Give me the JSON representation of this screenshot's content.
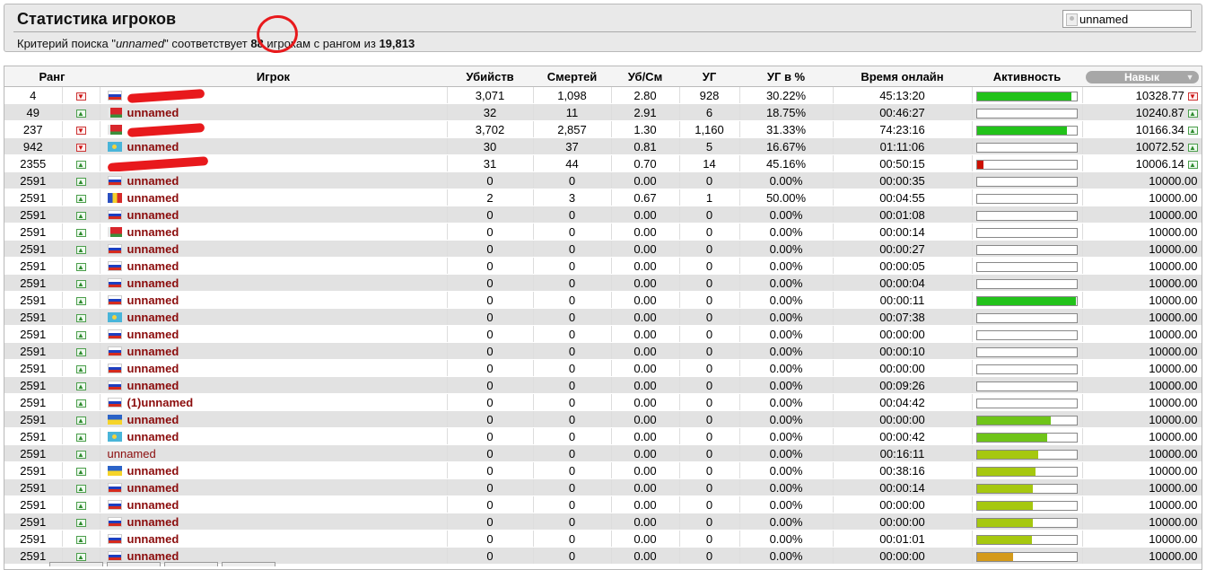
{
  "header": {
    "title": "Статистика игроков",
    "summary": {
      "prefix": "Критерий поиска \"",
      "query": "unnamed",
      "middle": "\" соответствует ",
      "count": "88",
      "after": " игрокам с рангом из ",
      "total": "19,813"
    },
    "search_value": "unnamed"
  },
  "columns": [
    "Ранг",
    "Игрок",
    "Убийств",
    "Смертей",
    "Уб/См",
    "УГ",
    "УГ в %",
    "Время онлайн",
    "Активность",
    "Навык"
  ],
  "colors": {
    "name": "#8b0c0c",
    "bar_green": "#22c21a",
    "bar_lime": "#a6c80f",
    "bar_red": "#cc1100",
    "bar_orange": "#d49a1a"
  },
  "rows": [
    {
      "rank": "4",
      "trend": "down",
      "flag": "ru",
      "name": "",
      "hidden": true,
      "kills": "3,071",
      "deaths": "1,098",
      "kd": "2.80",
      "hs": "928",
      "hsp": "30.22%",
      "time": "45:13:20",
      "activity": 95,
      "bar": "green",
      "skill": "10328.77",
      "strend": "down"
    },
    {
      "rank": "49",
      "trend": "up",
      "flag": "by",
      "name": "unnamed",
      "kills": "32",
      "deaths": "11",
      "kd": "2.91",
      "hs": "6",
      "hsp": "18.75%",
      "time": "00:46:27",
      "activity": 0,
      "bar": "green",
      "skill": "10240.87",
      "strend": "up"
    },
    {
      "rank": "237",
      "trend": "down",
      "flag": "by",
      "name": "",
      "hidden": true,
      "kills": "3,702",
      "deaths": "2,857",
      "kd": "1.30",
      "hs": "1,160",
      "hsp": "31.33%",
      "time": "74:23:16",
      "activity": 90,
      "bar": "green",
      "skill": "10166.34",
      "strend": "up"
    },
    {
      "rank": "942",
      "trend": "down",
      "flag": "kz",
      "name": "unnamed",
      "kills": "30",
      "deaths": "37",
      "kd": "0.81",
      "hs": "5",
      "hsp": "16.67%",
      "time": "01:11:06",
      "activity": 0,
      "bar": "green",
      "skill": "10072.52",
      "strend": "up"
    },
    {
      "rank": "2355",
      "trend": "up",
      "flag": "",
      "name": "",
      "hidden": true,
      "wide": true,
      "kills": "31",
      "deaths": "44",
      "kd": "0.70",
      "hs": "14",
      "hsp": "45.16%",
      "time": "00:50:15",
      "activity": 6,
      "bar": "red",
      "skill": "10006.14",
      "strend": "up"
    },
    {
      "rank": "2591",
      "trend": "up",
      "flag": "ru",
      "name": "unnamed",
      "kills": "0",
      "deaths": "0",
      "kd": "0.00",
      "hs": "0",
      "hsp": "0.00%",
      "time": "00:00:35",
      "activity": 0,
      "bar": "green",
      "skill": "10000.00",
      "strend": ""
    },
    {
      "rank": "2591",
      "trend": "up",
      "flag": "md",
      "name": "unnamed",
      "kills": "2",
      "deaths": "3",
      "kd": "0.67",
      "hs": "1",
      "hsp": "50.00%",
      "time": "00:04:55",
      "activity": 0,
      "bar": "green",
      "skill": "10000.00",
      "strend": ""
    },
    {
      "rank": "2591",
      "trend": "up",
      "flag": "ru",
      "name": "unnamed",
      "kills": "0",
      "deaths": "0",
      "kd": "0.00",
      "hs": "0",
      "hsp": "0.00%",
      "time": "00:01:08",
      "activity": 0,
      "bar": "green",
      "skill": "10000.00",
      "strend": ""
    },
    {
      "rank": "2591",
      "trend": "up",
      "flag": "by",
      "name": "unnamed",
      "kills": "0",
      "deaths": "0",
      "kd": "0.00",
      "hs": "0",
      "hsp": "0.00%",
      "time": "00:00:14",
      "activity": 0,
      "bar": "green",
      "skill": "10000.00",
      "strend": ""
    },
    {
      "rank": "2591",
      "trend": "up",
      "flag": "ru",
      "name": "unnamed",
      "kills": "0",
      "deaths": "0",
      "kd": "0.00",
      "hs": "0",
      "hsp": "0.00%",
      "time": "00:00:27",
      "activity": 0,
      "bar": "green",
      "skill": "10000.00",
      "strend": ""
    },
    {
      "rank": "2591",
      "trend": "up",
      "flag": "ru",
      "name": "unnamed",
      "kills": "0",
      "deaths": "0",
      "kd": "0.00",
      "hs": "0",
      "hsp": "0.00%",
      "time": "00:00:05",
      "activity": 0,
      "bar": "green",
      "skill": "10000.00",
      "strend": ""
    },
    {
      "rank": "2591",
      "trend": "up",
      "flag": "ru",
      "name": "unnamed",
      "kills": "0",
      "deaths": "0",
      "kd": "0.00",
      "hs": "0",
      "hsp": "0.00%",
      "time": "00:00:04",
      "activity": 0,
      "bar": "green",
      "skill": "10000.00",
      "strend": ""
    },
    {
      "rank": "2591",
      "trend": "up",
      "flag": "ru",
      "name": "unnamed",
      "kills": "0",
      "deaths": "0",
      "kd": "0.00",
      "hs": "0",
      "hsp": "0.00%",
      "time": "00:00:11",
      "activity": 99,
      "bar": "green",
      "skill": "10000.00",
      "strend": ""
    },
    {
      "rank": "2591",
      "trend": "up",
      "flag": "kz",
      "name": "unnamed",
      "kills": "0",
      "deaths": "0",
      "kd": "0.00",
      "hs": "0",
      "hsp": "0.00%",
      "time": "00:07:38",
      "activity": 0,
      "bar": "green",
      "skill": "10000.00",
      "strend": ""
    },
    {
      "rank": "2591",
      "trend": "up",
      "flag": "ru",
      "name": "unnamed",
      "kills": "0",
      "deaths": "0",
      "kd": "0.00",
      "hs": "0",
      "hsp": "0.00%",
      "time": "00:00:00",
      "activity": 0,
      "bar": "green",
      "skill": "10000.00",
      "strend": ""
    },
    {
      "rank": "2591",
      "trend": "up",
      "flag": "ru",
      "name": "unnamed",
      "kills": "0",
      "deaths": "0",
      "kd": "0.00",
      "hs": "0",
      "hsp": "0.00%",
      "time": "00:00:10",
      "activity": 0,
      "bar": "green",
      "skill": "10000.00",
      "strend": ""
    },
    {
      "rank": "2591",
      "trend": "up",
      "flag": "ru",
      "name": "unnamed",
      "kills": "0",
      "deaths": "0",
      "kd": "0.00",
      "hs": "0",
      "hsp": "0.00%",
      "time": "00:00:00",
      "activity": 0,
      "bar": "green",
      "skill": "10000.00",
      "strend": ""
    },
    {
      "rank": "2591",
      "trend": "up",
      "flag": "ru",
      "name": "unnamed",
      "kills": "0",
      "deaths": "0",
      "kd": "0.00",
      "hs": "0",
      "hsp": "0.00%",
      "time": "00:09:26",
      "activity": 0,
      "bar": "green",
      "skill": "10000.00",
      "strend": ""
    },
    {
      "rank": "2591",
      "trend": "up",
      "flag": "ru",
      "name": "(1)unnamed",
      "kills": "0",
      "deaths": "0",
      "kd": "0.00",
      "hs": "0",
      "hsp": "0.00%",
      "time": "00:04:42",
      "activity": 0,
      "bar": "green",
      "skill": "10000.00",
      "strend": ""
    },
    {
      "rank": "2591",
      "trend": "up",
      "flag": "ua",
      "name": "unnamed",
      "kills": "0",
      "deaths": "0",
      "kd": "0.00",
      "hs": "0",
      "hsp": "0.00%",
      "time": "00:00:00",
      "activity": 74,
      "bar": "green2",
      "skill": "10000.00",
      "strend": ""
    },
    {
      "rank": "2591",
      "trend": "up",
      "flag": "kz",
      "name": "unnamed",
      "kills": "0",
      "deaths": "0",
      "kd": "0.00",
      "hs": "0",
      "hsp": "0.00%",
      "time": "00:00:42",
      "activity": 70,
      "bar": "green2",
      "skill": "10000.00",
      "strend": ""
    },
    {
      "rank": "2591",
      "trend": "up",
      "flag": "",
      "name": "unnamed",
      "plain": true,
      "kills": "0",
      "deaths": "0",
      "kd": "0.00",
      "hs": "0",
      "hsp": "0.00%",
      "time": "00:16:11",
      "activity": 61,
      "bar": "lime",
      "skill": "10000.00",
      "strend": ""
    },
    {
      "rank": "2591",
      "trend": "up",
      "flag": "ua",
      "name": "unnamed",
      "kills": "0",
      "deaths": "0",
      "kd": "0.00",
      "hs": "0",
      "hsp": "0.00%",
      "time": "00:38:16",
      "activity": 59,
      "bar": "lime",
      "skill": "10000.00",
      "strend": ""
    },
    {
      "rank": "2591",
      "trend": "up",
      "flag": "ru",
      "name": "unnamed",
      "kills": "0",
      "deaths": "0",
      "kd": "0.00",
      "hs": "0",
      "hsp": "0.00%",
      "time": "00:00:14",
      "activity": 56,
      "bar": "lime",
      "skill": "10000.00",
      "strend": ""
    },
    {
      "rank": "2591",
      "trend": "up",
      "flag": "ru",
      "name": "unnamed",
      "kills": "0",
      "deaths": "0",
      "kd": "0.00",
      "hs": "0",
      "hsp": "0.00%",
      "time": "00:00:00",
      "activity": 56,
      "bar": "lime",
      "skill": "10000.00",
      "strend": ""
    },
    {
      "rank": "2591",
      "trend": "up",
      "flag": "ru",
      "name": "unnamed",
      "kills": "0",
      "deaths": "0",
      "kd": "0.00",
      "hs": "0",
      "hsp": "0.00%",
      "time": "00:00:00",
      "activity": 56,
      "bar": "lime",
      "skill": "10000.00",
      "strend": ""
    },
    {
      "rank": "2591",
      "trend": "up",
      "flag": "ru",
      "name": "unnamed",
      "kills": "0",
      "deaths": "0",
      "kd": "0.00",
      "hs": "0",
      "hsp": "0.00%",
      "time": "00:01:01",
      "activity": 55,
      "bar": "lime",
      "skill": "10000.00",
      "strend": ""
    },
    {
      "rank": "2591",
      "trend": "up",
      "flag": "ru",
      "name": "unnamed",
      "kills": "0",
      "deaths": "0",
      "kd": "0.00",
      "hs": "0",
      "hsp": "0.00%",
      "time": "00:00:00",
      "activity": 36,
      "bar": "orange",
      "skill": "10000.00",
      "strend": ""
    }
  ]
}
